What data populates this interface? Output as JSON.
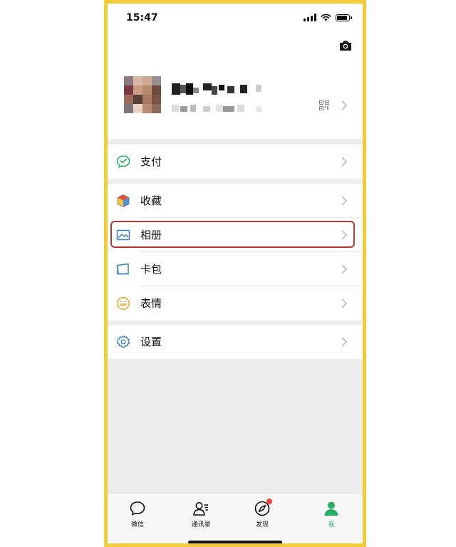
{
  "status_bar": {
    "time": "15:47"
  },
  "profile": {
    "name": "",
    "wechat_id": "",
    "avatar_colors": [
      "#8b7a80",
      "#d8b8a8",
      "#cfa793",
      "#9a8f90",
      "#7a3a40",
      "#c89b84",
      "#b88a6c",
      "#6e4a40",
      "#9a6b5a",
      "#5a4038",
      "#a87a62",
      "#7a5445",
      "#7d7578",
      "#e8d4c6",
      "#b68a72",
      "#8a6a5c"
    ]
  },
  "menu": {
    "pay": "支付",
    "favorites": "收藏",
    "album": "相册",
    "cards": "卡包",
    "stickers": "表情",
    "settings": "设置"
  },
  "tabbar": {
    "chats": "微信",
    "contacts": "通讯录",
    "discover": "发现",
    "me": "我"
  },
  "colors": {
    "frame_border": "#f2cd3a",
    "highlight_box": "#b23a35",
    "active_tab": "#2aae67",
    "badge": "#e64340",
    "background": "#ededed"
  }
}
